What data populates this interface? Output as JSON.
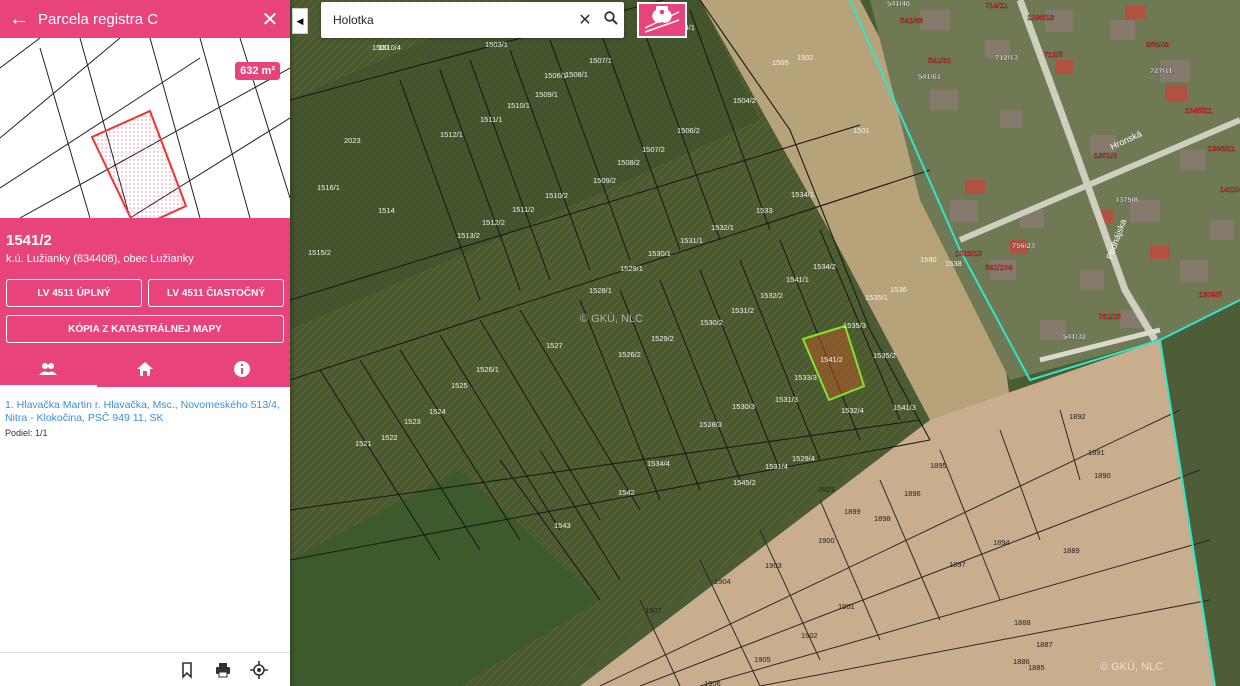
{
  "panel": {
    "title": "Parcela registra C",
    "area": "632 m²",
    "parcel_number": "1541/2",
    "cadastral_info": "k.ú. Lužianky (834408), obec Lužianky",
    "btn_full": "LV 4511 ÚPLNÝ",
    "btn_partial": "LV 4511 ČIASTOČNÝ",
    "btn_copy": "KÓPIA Z KATASTRÁLNEJ MAPY",
    "owner": "1. Hlavačka Martin r. Hlavačka, Msc., Novomeského 513/4, Nitra - Klokočina, PSČ 949 11, SK",
    "share": "Podiel: 1/1",
    "tabs": [
      "owners-icon",
      "home-icon",
      "info-icon"
    ]
  },
  "search": {
    "value": "Holotka"
  },
  "map": {
    "watermark": "© GKÚ, NLC",
    "parcels_left": [
      "1500",
      "1503/1",
      "1506/1",
      "1507/1",
      "1504/1",
      "1509/1",
      "1508/1",
      "1510/1",
      "1511/1",
      "1512/1",
      "1507/2",
      "1506/2",
      "1504/2",
      "1509/2",
      "1508/2",
      "1510/2",
      "1511/2",
      "1512/2",
      "1513/2",
      "1514",
      "1515/2",
      "1516/1",
      "1502",
      "1501",
      "1505",
      "2023",
      "1530/1",
      "1531/1",
      "1532/1",
      "1533",
      "1534/1",
      "1534/2",
      "1529/1",
      "1528/1",
      "1541/1",
      "1541/2",
      "1530/2",
      "1531/2",
      "1532/2",
      "1535/1",
      "1536",
      "1527",
      "1526/2",
      "1529/2",
      "1533/3",
      "1535/2",
      "1535/3",
      "1525",
      "1526/1",
      "1524",
      "1523",
      "1522",
      "1521",
      "1528/3",
      "1530/3",
      "1531/3",
      "1532/4",
      "1541/3",
      "1534/4",
      "1542",
      "1543",
      "1545/2",
      "1529/4",
      "1531/4",
      "1510/4",
      "1580",
      "1538",
      "1540"
    ],
    "parcels_right": [
      "1892",
      "1890",
      "1891",
      "1895",
      "1896",
      "1899",
      "1898",
      "1900",
      "1903",
      "1904",
      "1907",
      "1901",
      "1902",
      "1905",
      "1906",
      "1894",
      "1897",
      "1889",
      "1888",
      "1887",
      "1886",
      "1885",
      "2023"
    ],
    "streets": [
      "Hronská",
      "Podhájska"
    ],
    "house_labels": [
      "541/40",
      "541/63",
      "541/62",
      "541/61",
      "714/11",
      "1296/18",
      "712/13",
      "712/5",
      "856/43",
      "727/11",
      "1045/21",
      "1351/8",
      "1375/8",
      "1336/21",
      "1422/4",
      "756/23",
      "1023/15",
      "541/104",
      "541/32",
      "781/25",
      "1309/5"
    ],
    "colors": {
      "accent": "#e8437b",
      "boundary": "#2ee6c8",
      "selected": "#7fe62e"
    }
  }
}
